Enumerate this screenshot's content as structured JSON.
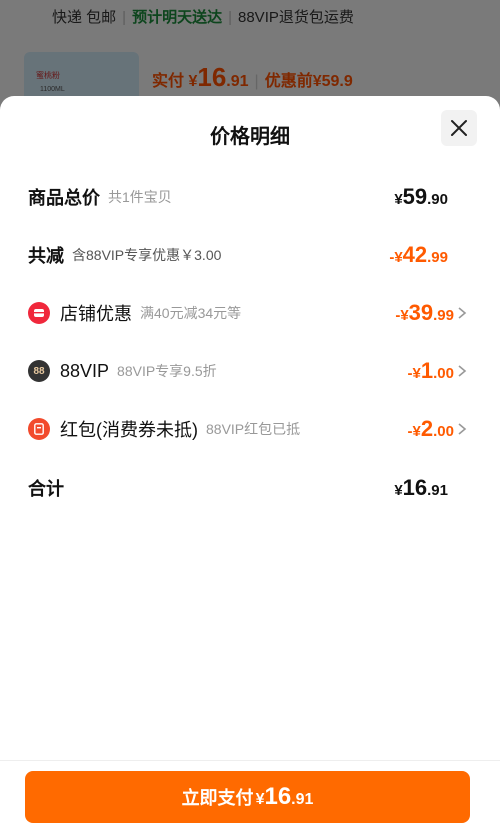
{
  "background": {
    "shipping_express": "快递 包邮",
    "shipping_eta": "预计明天送达",
    "shipping_vip": "88VIP退货包运费",
    "product_thumb_label": "蜜桃粉",
    "product_thumb_volume": "1100ML",
    "paid_label": "实付",
    "paid_currency": "¥",
    "paid_int": "16",
    "paid_dec": ".91",
    "before_label": "优惠前",
    "before_price": "¥59.9"
  },
  "sheet": {
    "title": "价格明细",
    "rows": [
      {
        "label": "商品总价",
        "sub": "共1件宝贝",
        "currency": "¥",
        "int": "59",
        "dec": ".90",
        "sign": ""
      },
      {
        "label": "共减",
        "sub": "含88VIP专享优惠￥3.00",
        "currency": "¥",
        "int": "42",
        "dec": ".99",
        "sign": "-"
      },
      {
        "label": "店铺优惠",
        "sub": "满40元减34元等",
        "currency": "¥",
        "int": "39",
        "dec": ".99",
        "sign": "-",
        "icon": "store-icon"
      },
      {
        "label": "88VIP",
        "sub": "88VIP专享9.5折",
        "currency": "¥",
        "int": "1",
        "dec": ".00",
        "sign": "-",
        "icon": "88vip-icon",
        "icon_text": "88"
      },
      {
        "label": "红包(消费券未抵)",
        "sub": "88VIP红包已抵",
        "currency": "¥",
        "int": "2",
        "dec": ".00",
        "sign": "-",
        "icon": "red-packet-icon"
      },
      {
        "label": "合计",
        "currency": "¥",
        "int": "16",
        "dec": ".91",
        "sign": ""
      }
    ]
  },
  "footer": {
    "pay_label": "立即支付",
    "pay_currency": "¥",
    "pay_int": "16",
    "pay_dec": ".91"
  },
  "colors": {
    "accent": "#ff6a00",
    "discount": "#ff5a00",
    "store_icon": "#f0283c",
    "vip_icon": "#333333",
    "red_packet_icon": "#f24a2c"
  }
}
